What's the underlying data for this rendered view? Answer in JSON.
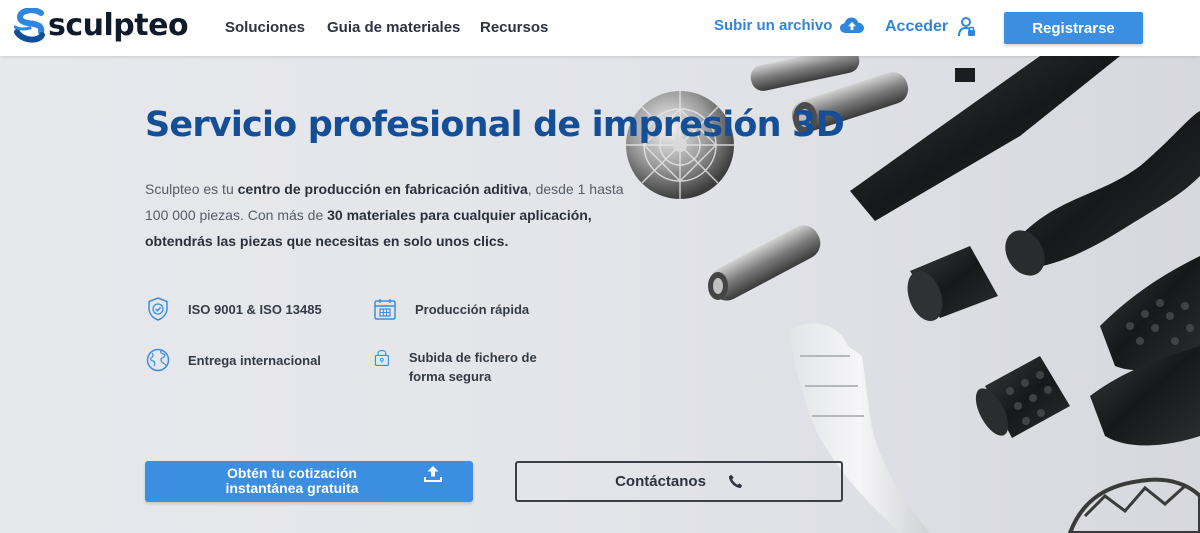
{
  "header": {
    "brand": "sculpteo",
    "nav": [
      {
        "label": "Soluciones"
      },
      {
        "label": "Guia de materiales"
      },
      {
        "label": "Recursos"
      }
    ],
    "upload_label": "Subir un archivo",
    "upload_icon": "cloud-upload-icon",
    "login_label": "Acceder",
    "login_icon": "user-login-icon",
    "register_label": "Registrarse"
  },
  "hero": {
    "title": "Servicio profesional de impresión 3D",
    "description": {
      "p1": "Sculpteo es tu ",
      "b1": "centro de producción en fabricación aditiva",
      "p2": ", desde 1 hasta 100 000 piezas. Con más de ",
      "b2": "30 materiales para cualquier aplicación, obtendrás las piezas que necesitas en solo unos clics."
    },
    "features": [
      {
        "label": "ISO 9001 & ISO 13485",
        "icon": "shield-check-icon"
      },
      {
        "label": "Producción rápida",
        "icon": "calendar-icon"
      },
      {
        "label": "Entrega internacional",
        "icon": "globe-icon"
      },
      {
        "label": "Subida de fichero de forma segura",
        "icon": "padlock-icon"
      }
    ],
    "quote_button": {
      "line1": "Obtén tu cotización",
      "line2": "instantánea gratuita",
      "icon": "upload-icon"
    },
    "contact_button": {
      "label": "Contáctanos",
      "icon": "phone-icon"
    }
  },
  "colors": {
    "brand_blue": "#144e97",
    "accent_blue": "#3b8ee0",
    "link_blue": "#2e86de",
    "text_dark": "#2d3340"
  }
}
